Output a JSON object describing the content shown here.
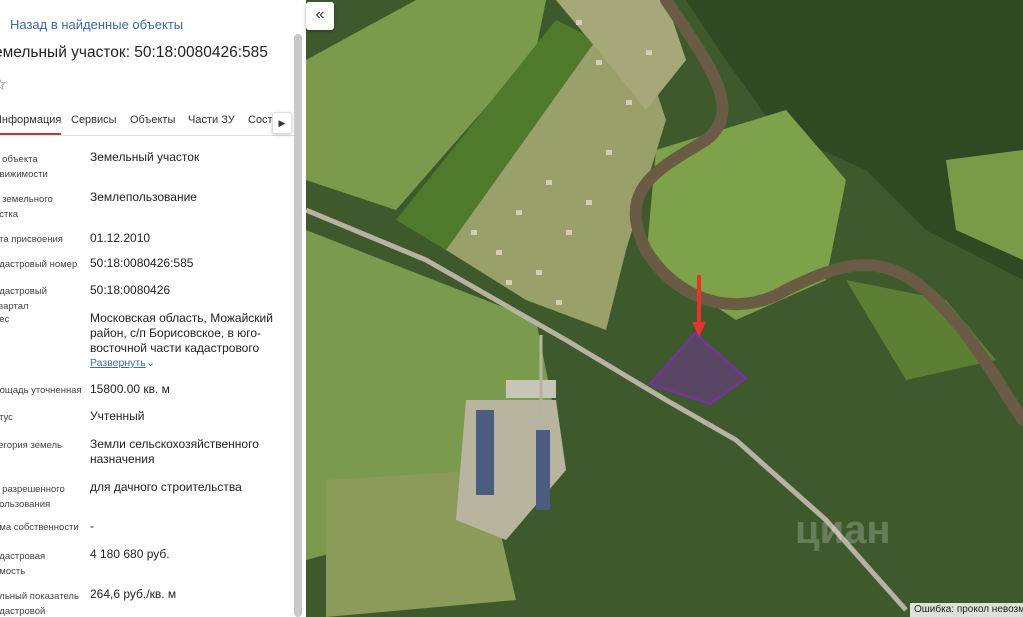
{
  "nav": {
    "back_link": "Назад в найденные объекты"
  },
  "object": {
    "title": "емельный участок: 50:18:0080426:585"
  },
  "tabs": [
    {
      "label": "Информация"
    },
    {
      "label": "Сервисы"
    },
    {
      "label": "Объекты"
    },
    {
      "label": "Части ЗУ"
    },
    {
      "label": "Соста"
    }
  ],
  "tabs_next": "▶",
  "fields": [
    {
      "label": "д объекта\nдвижимости",
      "value": "Земельный участок"
    },
    {
      "label": "д земельного\nастка",
      "value": "Землепользование"
    },
    {
      "label": "ата присвоения",
      "value": "01.12.2010"
    },
    {
      "label": "адастровый номер",
      "value": "50:18:0080426:585"
    },
    {
      "label": "адастровый квартал",
      "value": "50:18:0080426"
    },
    {
      "label": "рес",
      "value": "Московская область, Можайский район, с/п Борисовское, в юго-восточной части кадастрового"
    },
    {
      "label": "лощадь уточненная",
      "value": "15800.00 кв. м"
    },
    {
      "label": "атус",
      "value": "Учтенный"
    },
    {
      "label": "тегория земель",
      "value": "Земли сельскохозяйственного назначения"
    },
    {
      "label": "д разрешенного\nпользования",
      "value": "для дачного строительства"
    },
    {
      "label": "рма собственности",
      "value": "-"
    },
    {
      "label": "адастровая\nимость",
      "value": "4 180 680 руб."
    },
    {
      "label": "альный показатель\nадастровой",
      "value": "264,6 руб./кв. м"
    }
  ],
  "expand_link": "Развернуть",
  "map": {
    "collapse_button": "«",
    "error_text": "Ошибка: прокол невозм",
    "watermark": "циан",
    "parcel_color": "#7a2fa8",
    "marker_color": "#e8332b"
  }
}
